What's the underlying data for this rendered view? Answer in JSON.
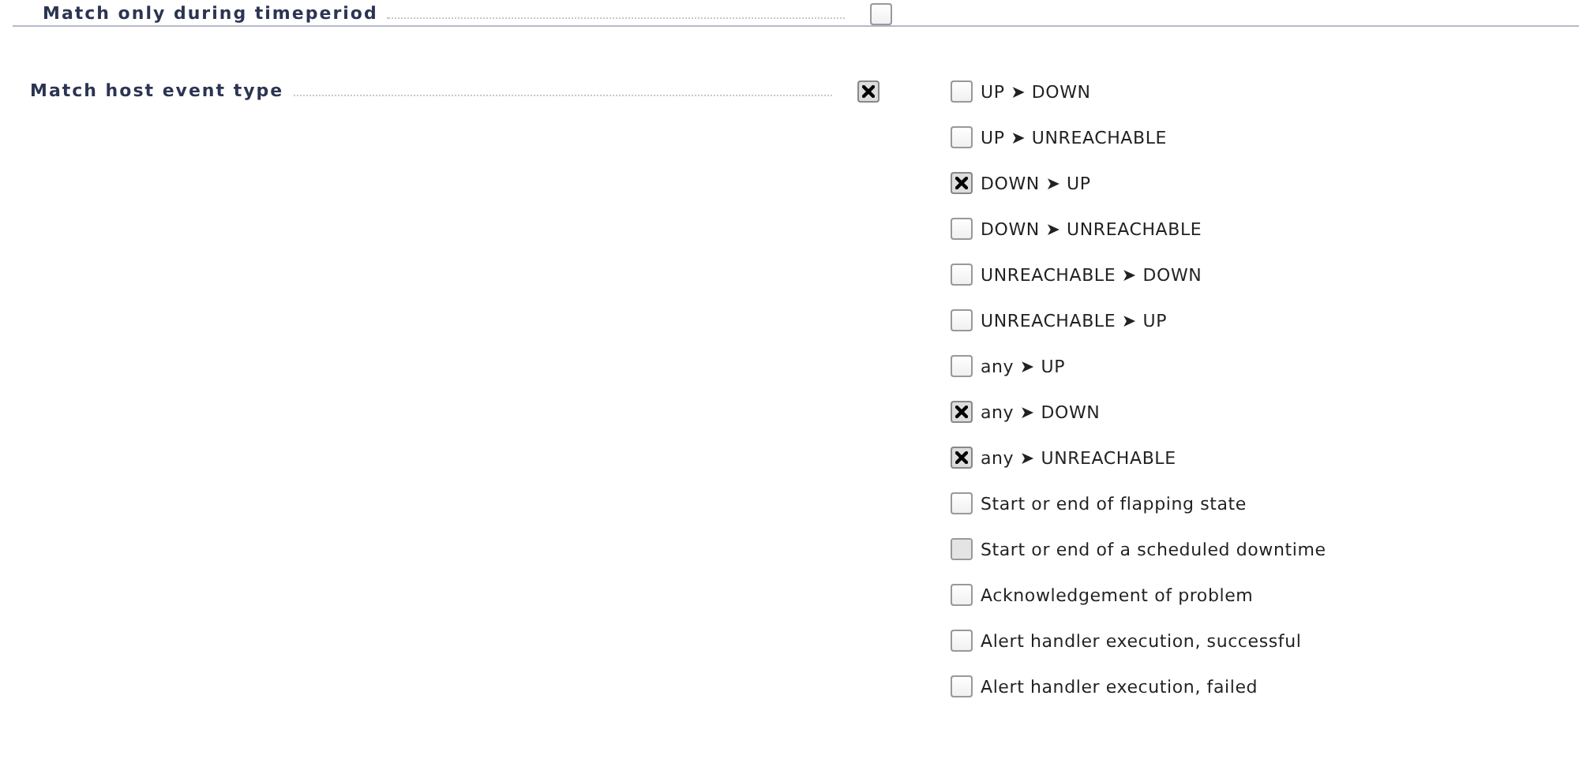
{
  "settings": [
    {
      "label": "Match only during timeperiod",
      "checked": false
    },
    {
      "label": "Match host event type",
      "checked": true,
      "options": [
        {
          "label": "UP ➤ DOWN",
          "checked": false,
          "highlighted": false
        },
        {
          "label": "UP ➤ UNREACHABLE",
          "checked": false,
          "highlighted": false
        },
        {
          "label": "DOWN ➤ UP",
          "checked": true,
          "highlighted": false
        },
        {
          "label": "DOWN ➤ UNREACHABLE",
          "checked": false,
          "highlighted": false
        },
        {
          "label": "UNREACHABLE ➤ DOWN",
          "checked": false,
          "highlighted": false
        },
        {
          "label": "UNREACHABLE ➤ UP",
          "checked": false,
          "highlighted": false
        },
        {
          "label": "any ➤ UP",
          "checked": false,
          "highlighted": false
        },
        {
          "label": "any ➤ DOWN",
          "checked": true,
          "highlighted": false
        },
        {
          "label": "any ➤ UNREACHABLE",
          "checked": true,
          "highlighted": false
        },
        {
          "label": "Start or end of flapping state",
          "checked": false,
          "highlighted": false
        },
        {
          "label": "Start or end of a scheduled downtime",
          "checked": false,
          "highlighted": true
        },
        {
          "label": "Acknowledgement of problem",
          "checked": false,
          "highlighted": false
        },
        {
          "label": "Alert handler execution, successful",
          "checked": false,
          "highlighted": false
        },
        {
          "label": "Alert handler execution, failed",
          "checked": false,
          "highlighted": false
        }
      ]
    }
  ]
}
